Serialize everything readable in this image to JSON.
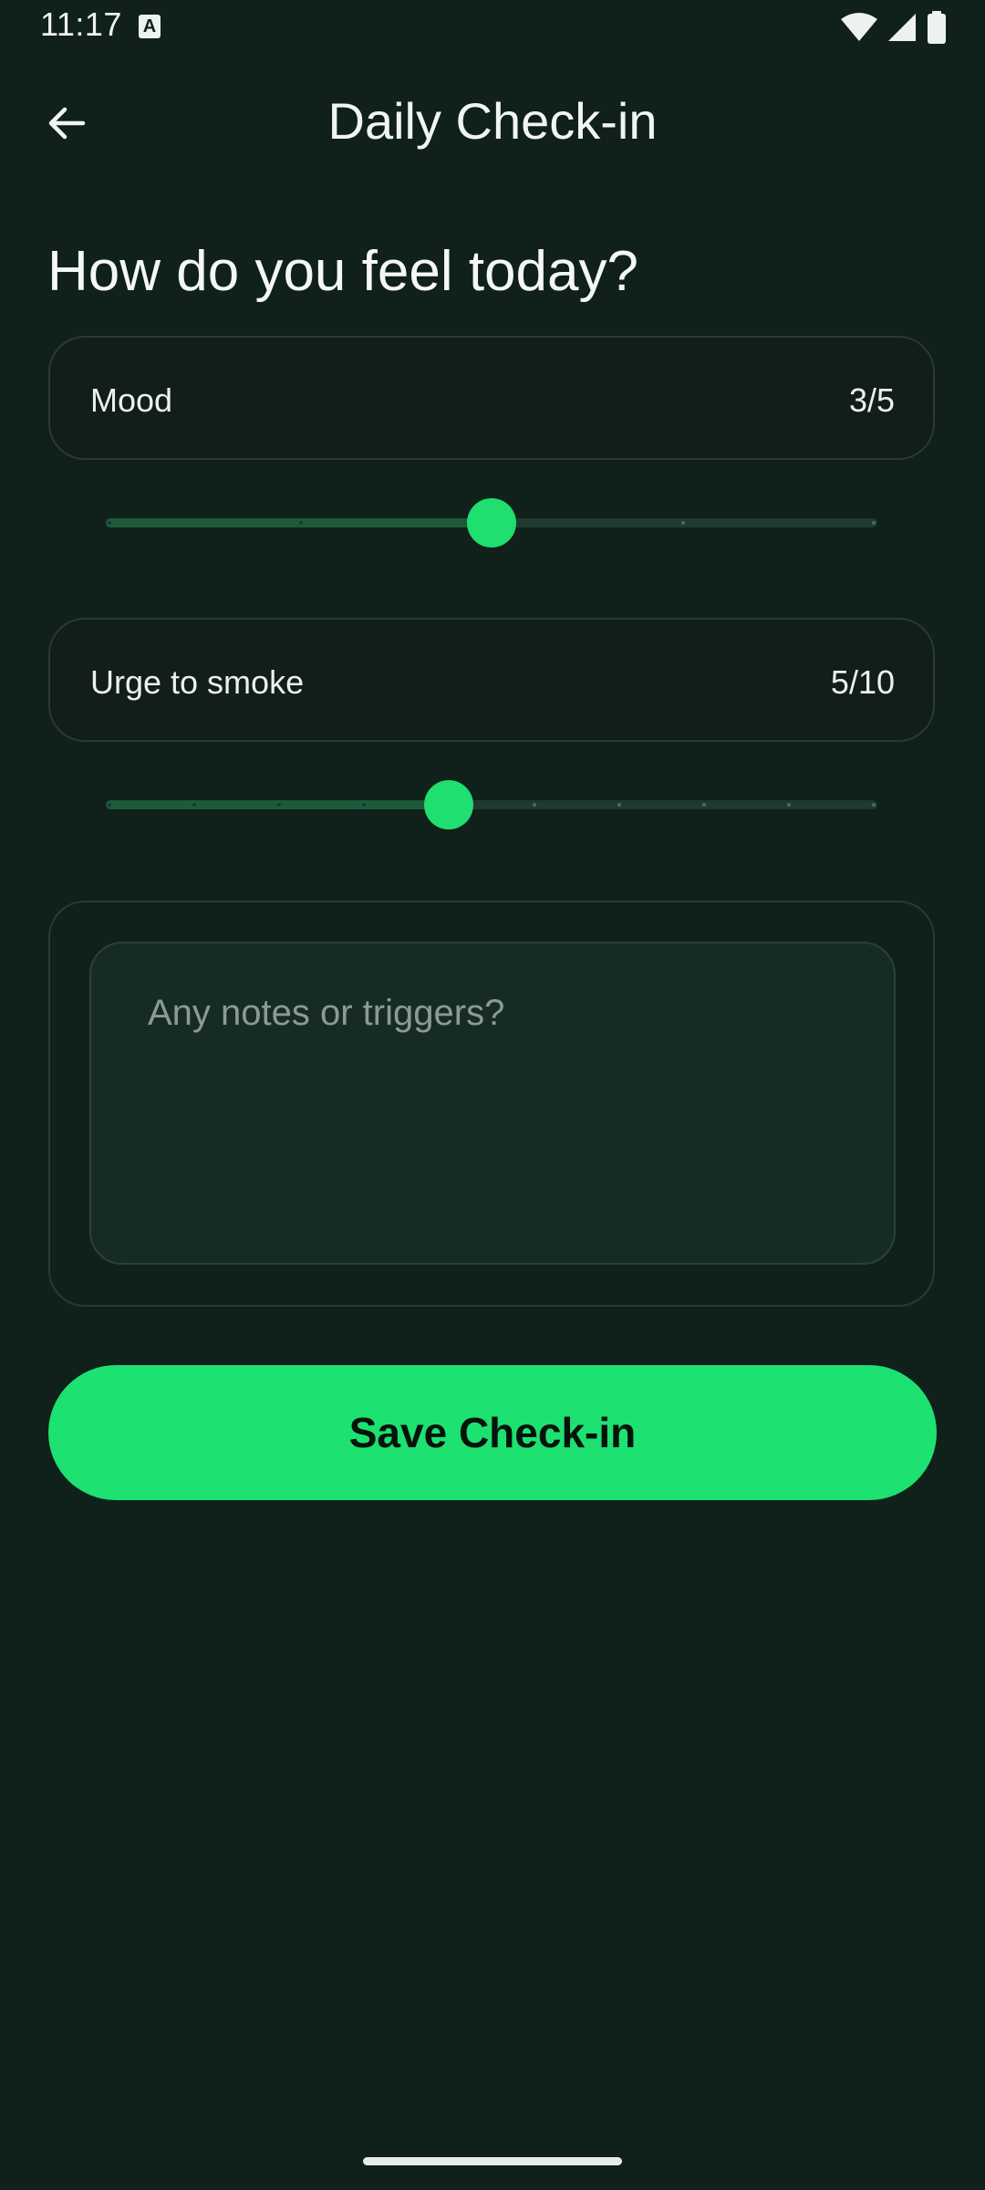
{
  "status_bar": {
    "time": "11:17",
    "notification_icon": "a-badge-icon",
    "wifi_icon": "wifi-icon",
    "signal_icon": "cell-signal-icon",
    "battery_icon": "battery-icon"
  },
  "app_bar": {
    "back_icon": "arrow-left-icon",
    "title": "Daily Check-in"
  },
  "heading": "How do you feel today?",
  "mood": {
    "label": "Mood",
    "value_text": "3/5",
    "value": 3,
    "min": 1,
    "max": 5
  },
  "urge": {
    "label": "Urge to smoke",
    "value_text": "5/10",
    "value": 5,
    "min": 1,
    "max": 10
  },
  "notes": {
    "placeholder": "Any notes or triggers?",
    "value": ""
  },
  "save_button": {
    "label": "Save Check-in"
  },
  "colors": {
    "background": "#10201b",
    "accent": "#1de170",
    "slider_active": "#1d5a3a",
    "slider_inactive": "#1f3a2f"
  }
}
